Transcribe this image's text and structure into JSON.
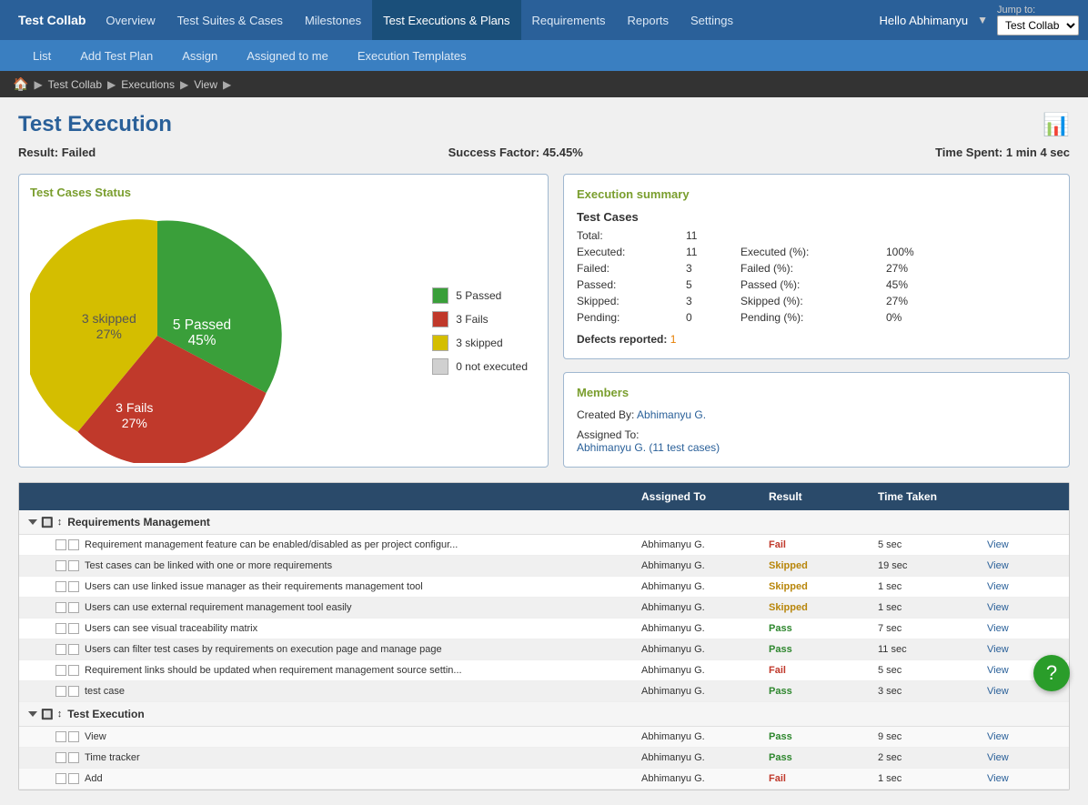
{
  "brand": "Test Collab",
  "topNav": {
    "links": [
      {
        "label": "Overview",
        "active": false
      },
      {
        "label": "Test Suites & Cases",
        "active": false
      },
      {
        "label": "Milestones",
        "active": false
      },
      {
        "label": "Test Executions & Plans",
        "active": true
      },
      {
        "label": "Requirements",
        "active": false
      },
      {
        "label": "Reports",
        "active": false
      },
      {
        "label": "Settings",
        "active": false
      }
    ],
    "userLabel": "Hello Abhimanyu",
    "jumpToLabel": "Jump to:",
    "jumpToValue": "Test Collab"
  },
  "subNav": {
    "links": [
      {
        "label": "List",
        "active": false
      },
      {
        "label": "Add Test Plan",
        "active": false
      },
      {
        "label": "Assign",
        "active": false
      },
      {
        "label": "Assigned to me",
        "active": false
      },
      {
        "label": "Execution Templates",
        "active": false
      }
    ]
  },
  "breadcrumb": {
    "home": "🏠",
    "items": [
      "Test Collab",
      "Executions",
      "View"
    ]
  },
  "pageTitle": "Test Execution",
  "result": {
    "label": "Result:",
    "value": "Failed",
    "successLabel": "Success Factor:",
    "successValue": "45.45%",
    "timeLabel": "Time Spent:",
    "timeValue": "1 min 4 sec"
  },
  "testCasesStatus": {
    "title": "Test Cases Status",
    "pieData": [
      {
        "label": "5 Passed",
        "percent": 45,
        "color": "#3a9f3a",
        "startAngle": 0,
        "endAngle": 162
      },
      {
        "label": "3 Fails",
        "percent": 27,
        "color": "#c0392b",
        "startAngle": 162,
        "endAngle": 259.2
      },
      {
        "label": "3 skipped",
        "percent": 28,
        "color": "#e0c020",
        "startAngle": 259.2,
        "endAngle": 360
      }
    ],
    "legend": [
      {
        "label": "5 Passed",
        "color": "#3a9f3a"
      },
      {
        "label": "3 Fails",
        "color": "#c0392b"
      },
      {
        "label": "3 skipped",
        "color": "#e0c020"
      },
      {
        "label": "0 not executed",
        "color": "#d0d0d0"
      }
    ]
  },
  "executionSummary": {
    "title": "Execution summary",
    "testCasesHeader": "Test Cases",
    "rows": [
      {
        "label": "Total:",
        "value": "11",
        "label2": "",
        "value2": ""
      },
      {
        "label": "Executed:",
        "value": "11",
        "label2": "Executed (%):",
        "value2": "100%"
      },
      {
        "label": "Failed:",
        "value": "3",
        "label2": "Failed (%):",
        "value2": "27%"
      },
      {
        "label": "Passed:",
        "value": "5",
        "label2": "Passed (%):",
        "value2": "45%"
      },
      {
        "label": "Skipped:",
        "value": "3",
        "label2": "Skipped (%):",
        "value2": "27%"
      },
      {
        "label": "Pending:",
        "value": "0",
        "label2": "Pending (%):",
        "value2": "0%"
      }
    ],
    "defectsLabel": "Defects reported:",
    "defectsCount": "1"
  },
  "members": {
    "title": "Members",
    "createdByLabel": "Created By:",
    "createdByValue": "Abhimanyu G.",
    "assignedToLabel": "Assigned To:",
    "assignedToValue": "Abhimanyu G. (11 test cases)"
  },
  "tableHeader": {
    "col1": "",
    "col2": "Assigned To",
    "col3": "Result",
    "col4": "Time Taken",
    "col5": ""
  },
  "groups": [
    {
      "name": "Requirements Management",
      "rows": [
        {
          "name": "Requirement management feature can be enabled/disabled as per project configur...",
          "assignedTo": "Abhimanyu G.",
          "result": "Fail",
          "timeTaken": "5 sec"
        },
        {
          "name": "Test cases can be linked with one or more requirements",
          "assignedTo": "Abhimanyu G.",
          "result": "Skipped",
          "timeTaken": "19 sec"
        },
        {
          "name": "Users can use linked issue manager as their requirements management tool",
          "assignedTo": "Abhimanyu G.",
          "result": "Skipped",
          "timeTaken": "1 sec"
        },
        {
          "name": "Users can use external requirement management tool easily",
          "assignedTo": "Abhimanyu G.",
          "result": "Skipped",
          "timeTaken": "1 sec"
        },
        {
          "name": "Users can see visual traceability matrix",
          "assignedTo": "Abhimanyu G.",
          "result": "Pass",
          "timeTaken": "7 sec"
        },
        {
          "name": "Users can filter test cases by requirements on execution page and manage page",
          "assignedTo": "Abhimanyu G.",
          "result": "Pass",
          "timeTaken": "11 sec"
        },
        {
          "name": "Requirement links should be updated when requirement management source settin...",
          "assignedTo": "Abhimanyu G.",
          "result": "Fail",
          "timeTaken": "5 sec"
        },
        {
          "name": "test case",
          "assignedTo": "Abhimanyu G.",
          "result": "Pass",
          "timeTaken": "3 sec"
        }
      ]
    },
    {
      "name": "Test Execution",
      "rows": [
        {
          "name": "View",
          "assignedTo": "Abhimanyu G.",
          "result": "Pass",
          "timeTaken": "9 sec"
        },
        {
          "name": "Time tracker",
          "assignedTo": "Abhimanyu G.",
          "result": "Pass",
          "timeTaken": "2 sec"
        },
        {
          "name": "Add",
          "assignedTo": "Abhimanyu G.",
          "result": "Fail",
          "timeTaken": "1 sec"
        }
      ]
    }
  ],
  "viewLabel": "View",
  "fabLabel": "?"
}
